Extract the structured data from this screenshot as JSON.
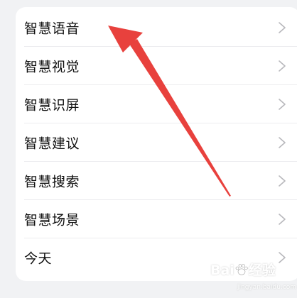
{
  "settings_list": {
    "items": [
      {
        "label": "智慧语音"
      },
      {
        "label": "智慧视觉"
      },
      {
        "label": "智慧识屏"
      },
      {
        "label": "智慧建议"
      },
      {
        "label": "智慧搜索"
      },
      {
        "label": "智慧场景"
      },
      {
        "label": "今天"
      }
    ]
  },
  "annotation": {
    "color": "#e8413d"
  },
  "watermark": {
    "brand_prefix": "Bai",
    "brand_suffix": "经验",
    "sub": "jingyan.baidu.com"
  },
  "colors": {
    "background": "#f1f2f4",
    "card": "#ffffff",
    "text": "#111111",
    "chevron": "#b8b8bc"
  }
}
